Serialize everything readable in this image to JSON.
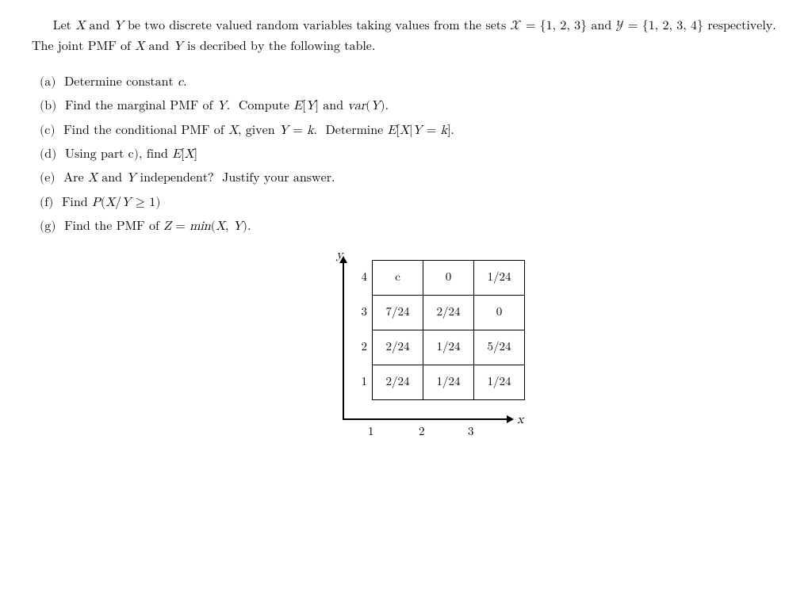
{
  "intro": {
    "text": "Let X and Y be two discrete valued random variables taking values from the sets 𝒳 = {1, 2, 3} and 𝒴 = {1, 2, 3, 4} respectively. The joint PMF of X and Y is decribed by the following table."
  },
  "parts": [
    {
      "label": "(a)",
      "text": "Determine constant c."
    },
    {
      "label": "(b)",
      "text": "Find the marginal PMF of Y. Compute E[Y] and var(Y)."
    },
    {
      "label": "(c)",
      "text": "Find the conditional PMF of X, given Y = k. Determine E[X|Y = k]."
    },
    {
      "label": "(d)",
      "text": "Using part c), find E[X]"
    },
    {
      "label": "(e)",
      "text": "Are X and Y independent? Justify your answer."
    },
    {
      "label": "(f)",
      "text": "Find P(X/Y ≥ 1)"
    },
    {
      "label": "(g)",
      "text": "Find the PMF of Z = min(X, Y)."
    }
  ],
  "table": {
    "y_axis_label": "y",
    "x_axis_label": "x",
    "rows": [
      {
        "y_val": "4",
        "cells": [
          "c",
          "0",
          "1/24"
        ]
      },
      {
        "y_val": "3",
        "cells": [
          "7/24",
          "2/24",
          "0"
        ]
      },
      {
        "y_val": "2",
        "cells": [
          "2/24",
          "1/24",
          "5/24"
        ]
      },
      {
        "y_val": "1",
        "cells": [
          "2/24",
          "1/24",
          "1/24"
        ]
      }
    ],
    "x_ticks": [
      "1",
      "2",
      "3"
    ]
  },
  "colors": {
    "background": "#ffffff",
    "text": "#000000",
    "border": "#000000"
  }
}
